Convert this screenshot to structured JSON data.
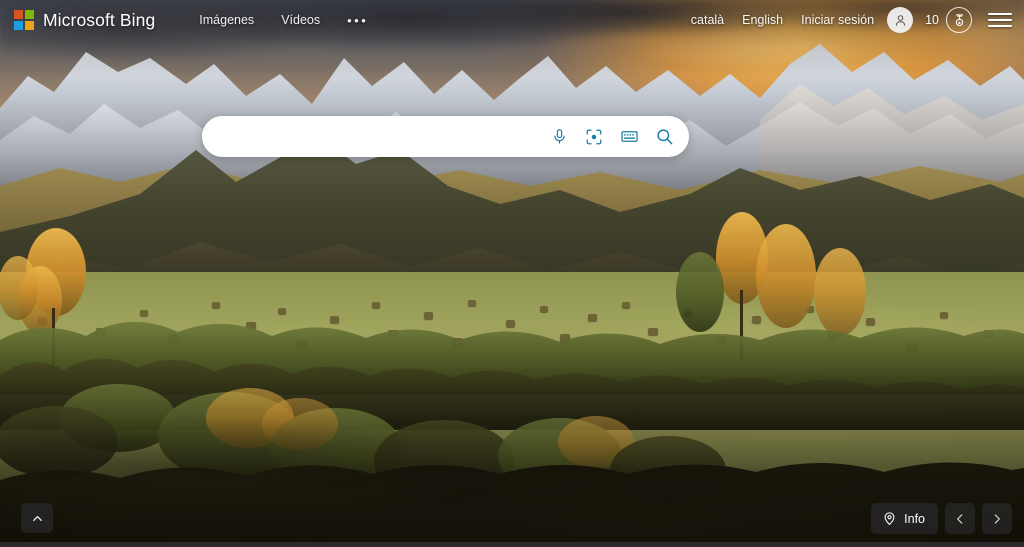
{
  "header": {
    "brand": {
      "name": "Microsoft Bing",
      "logo_icon": "microsoft-logo-icon"
    },
    "nav": [
      {
        "label": "Imágenes",
        "name": "nav-images"
      },
      {
        "label": "Vídeos",
        "name": "nav-videos"
      },
      {
        "label": "•••",
        "name": "nav-more"
      }
    ],
    "right": {
      "lang_catalan": "català",
      "lang_english": "English",
      "sign_in": "Iniciar sesión",
      "avatar_icon": "person-avatar-icon",
      "rewards_count": "10",
      "rewards_icon": "rewards-medal-icon",
      "menu_icon": "hamburger-menu-icon"
    }
  },
  "search": {
    "value": "",
    "placeholder": "",
    "icons": [
      {
        "name": "microphone-icon"
      },
      {
        "name": "visual-search-camera-icon"
      },
      {
        "name": "keyboard-icon"
      },
      {
        "name": "search-magnifier-icon"
      }
    ]
  },
  "bottom": {
    "scroll_up_icon": "chevron-up-icon",
    "info_label": "Info",
    "info_icon": "location-pin-icon",
    "prev_icon": "chevron-left-icon",
    "next_icon": "chevron-right-icon"
  },
  "colors": {
    "ms_red": "#d9541e",
    "ms_green": "#7cbb00",
    "ms_blue": "#1ba1e2",
    "ms_yellow": "#e8a317",
    "search_icon_blue": "#1b7fa8",
    "search_bg": "#ffffff",
    "control_bg": "rgba(38,38,38,0.78)"
  },
  "background": {
    "description": "Sunset mountain landscape with snow-capped peaks, golden clouds, autumn trees and a hay-bale meadow"
  }
}
